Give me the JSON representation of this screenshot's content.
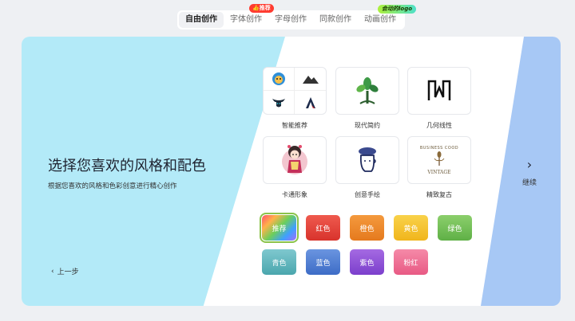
{
  "tabs": [
    {
      "label": "自由创作",
      "active": true
    },
    {
      "label": "字体创作",
      "active": false
    },
    {
      "label": "字母创作",
      "active": false
    },
    {
      "label": "同款创作",
      "active": false
    },
    {
      "label": "动画创作",
      "active": false
    }
  ],
  "badges": {
    "hot": "推荐",
    "new": "会动的logo"
  },
  "heading": "选择您喜欢的风格和配色",
  "subheading": "根据您喜欢的风格和色彩创意进行精心创作",
  "prev_label": "上一步",
  "next_label": "继续",
  "styles": [
    {
      "label": "智能推荐",
      "icon": "mixed-logos-icon"
    },
    {
      "label": "现代简约",
      "icon": "tree-logo-icon"
    },
    {
      "label": "几何线性",
      "icon": "geometric-w-icon"
    },
    {
      "label": "卡通形象",
      "icon": "cartoon-girl-icon"
    },
    {
      "label": "创意手绘",
      "icon": "hand-drawn-head-icon"
    },
    {
      "label": "精致复古",
      "icon": "vintage-badge-icon"
    }
  ],
  "vintage_badge_text": {
    "top": "BUSINESS COOD",
    "bottom": "VINTAGE"
  },
  "colors": [
    {
      "label": "推荐",
      "color": "rainbow",
      "selected": true
    },
    {
      "label": "红色",
      "color": "#e8423c"
    },
    {
      "label": "橙色",
      "color": "#f08a2c"
    },
    {
      "label": "黄色",
      "color": "#f6c42e"
    },
    {
      "label": "绿色",
      "color": "#74c05a"
    },
    {
      "label": "青色",
      "color": "#5cb8bf"
    },
    {
      "label": "蓝色",
      "color": "#4d7fd4"
    },
    {
      "label": "紫色",
      "color": "#8e4fd6"
    },
    {
      "label": "粉红",
      "color": "#ef6c92"
    }
  ]
}
